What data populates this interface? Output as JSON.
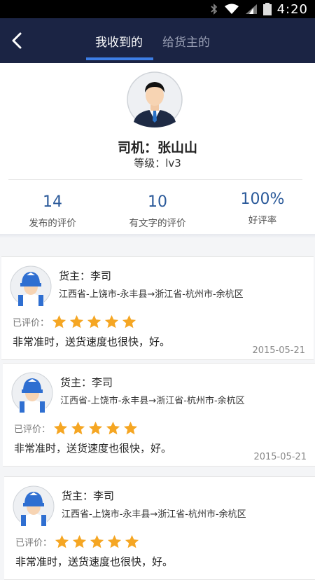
{
  "status_bar": {
    "time": "4:20"
  },
  "nav": {
    "tabs": [
      {
        "label": "我收到的",
        "active": true
      },
      {
        "label": "给货主的",
        "active": false
      }
    ]
  },
  "profile": {
    "name_line": "司机：张山山",
    "level_line": "等级：lv3",
    "stats": [
      {
        "value": "14",
        "label": "发布的评价"
      },
      {
        "value": "10",
        "label": "有文字的评价"
      },
      {
        "value": "100%",
        "label": "好评率"
      }
    ]
  },
  "reviews": [
    {
      "owner": "货主：李司",
      "route": "江西省-上饶市-永丰县→浙江省-杭州市-余杭区",
      "rated_label": "已评价：",
      "stars": 5,
      "comment": "非常准时，送货速度也很快，好。",
      "date": "2015-05-21"
    },
    {
      "owner": "货主：李司",
      "route": "江西省-上饶市-永丰县→浙江省-杭州市-余杭区",
      "rated_label": "已评价：",
      "stars": 5,
      "comment": "非常准时，送货速度也很快，好。",
      "date": "2015-05-21"
    },
    {
      "owner": "货主：李司",
      "route": "江西省-上饶市-永丰县→浙江省-杭州市-余杭区",
      "rated_label": "已评价：",
      "stars": 5,
      "comment": "非常准时，送货速度也很快，好。",
      "date": ""
    }
  ],
  "colors": {
    "nav_bg": "#1b2444",
    "tab_underline": "#3d7ee6",
    "star": "#f5a623",
    "stat_number": "#2b5a9a"
  },
  "icons": {
    "back": "chevron-left-icon",
    "signal": "bluetooth/wifi/signal/battery"
  }
}
